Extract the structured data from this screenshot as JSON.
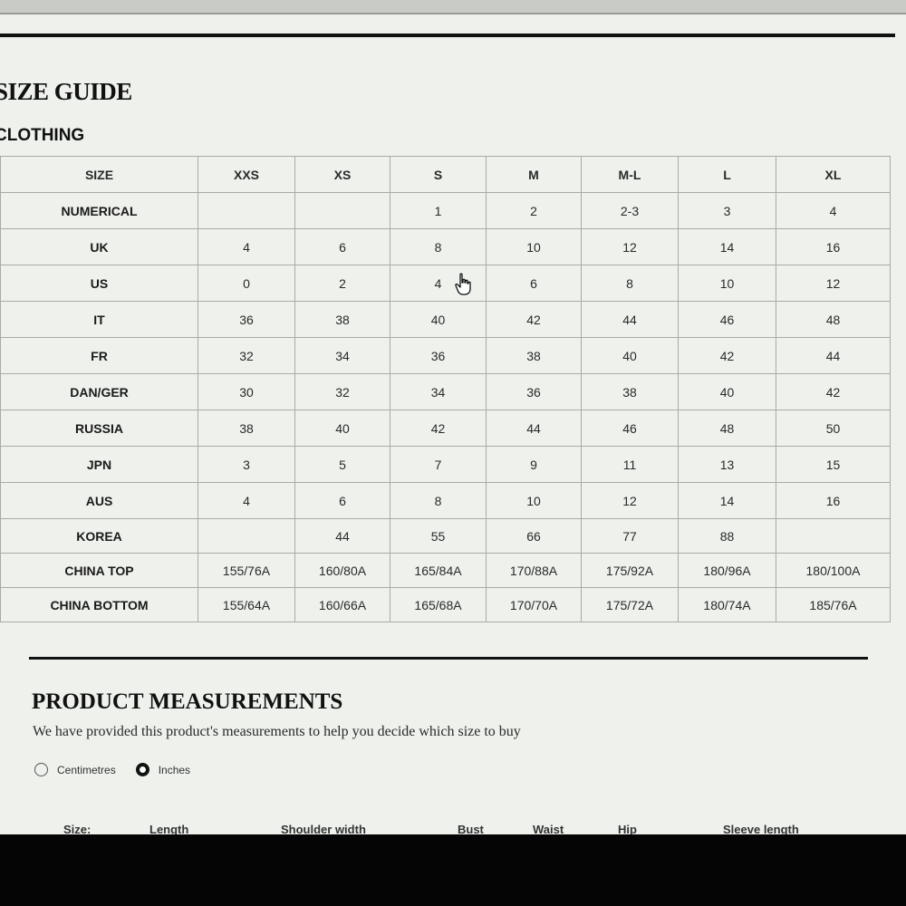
{
  "page": {
    "title": "SIZE GUIDE",
    "section": "CLOTHING"
  },
  "size_table": {
    "columns": [
      "SIZE",
      "XXS",
      "XS",
      "S",
      "M",
      "M-L",
      "L",
      "XL"
    ],
    "rows": [
      {
        "label": "NUMERICAL",
        "values": [
          "",
          "",
          "1",
          "2",
          "2-3",
          "3",
          "4"
        ]
      },
      {
        "label": "UK",
        "values": [
          "4",
          "6",
          "8",
          "10",
          "12",
          "14",
          "16"
        ]
      },
      {
        "label": "US",
        "values": [
          "0",
          "2",
          "4",
          "6",
          "8",
          "10",
          "12"
        ]
      },
      {
        "label": "IT",
        "values": [
          "36",
          "38",
          "40",
          "42",
          "44",
          "46",
          "48"
        ]
      },
      {
        "label": "FR",
        "values": [
          "32",
          "34",
          "36",
          "38",
          "40",
          "42",
          "44"
        ]
      },
      {
        "label": "DAN/GER",
        "values": [
          "30",
          "32",
          "34",
          "36",
          "38",
          "40",
          "42"
        ]
      },
      {
        "label": "RUSSIA",
        "values": [
          "38",
          "40",
          "42",
          "44",
          "46",
          "48",
          "50"
        ]
      },
      {
        "label": "JPN",
        "values": [
          "3",
          "5",
          "7",
          "9",
          "11",
          "13",
          "15"
        ]
      },
      {
        "label": "AUS",
        "values": [
          "4",
          "6",
          "8",
          "10",
          "12",
          "14",
          "16"
        ]
      },
      {
        "label": "KOREA",
        "values": [
          "",
          "44",
          "55",
          "66",
          "77",
          "88",
          ""
        ]
      },
      {
        "label": "CHINA TOP",
        "values": [
          "155/76A",
          "160/80A",
          "165/84A",
          "170/88A",
          "175/92A",
          "180/96A",
          "180/100A"
        ]
      },
      {
        "label": "CHINA BOTTOM",
        "values": [
          "155/64A",
          "160/66A",
          "165/68A",
          "170/70A",
          "175/72A",
          "180/74A",
          "185/76A"
        ]
      }
    ]
  },
  "product_measurements": {
    "title": "PRODUCT MEASUREMENTS",
    "description": "We have provided this product's measurements to help you decide which size to buy",
    "units": {
      "options": [
        "Centimetres",
        "Inches"
      ],
      "selected": "Inches"
    },
    "headers": [
      "Size:",
      "Length",
      "Shoulder width",
      "Bust",
      "Waist",
      "Hip",
      "Sleeve length"
    ]
  }
}
